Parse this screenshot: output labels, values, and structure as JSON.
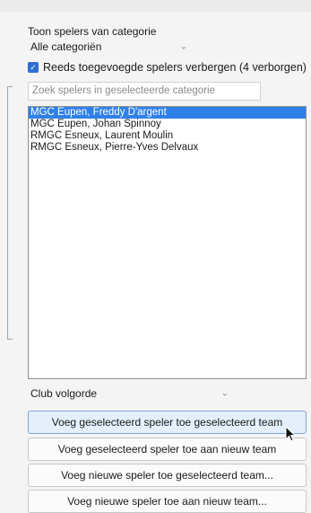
{
  "panel": {
    "category_label": "Toon spelers van categorie",
    "category_select": {
      "value": "Alle categoriën"
    },
    "hide_added": {
      "checked": true,
      "label": "Reeds toegevoegde spelers verbergen (4 verborgen)"
    },
    "search": {
      "placeholder": "Zoek spelers in geselecteerde categorie"
    },
    "players": [
      {
        "name": "MGC Eupen, Freddy D'argent",
        "selected": true
      },
      {
        "name": "MGC Eupen, Johan Spinnoy",
        "selected": false
      },
      {
        "name": "RMGC Esneux, Laurent Moulin",
        "selected": false
      },
      {
        "name": "RMGC Esneux, Pierre-Yves Delvaux",
        "selected": false
      }
    ],
    "sort_select": {
      "value": "Club volgorde"
    },
    "buttons": {
      "add_selected_to_selected": "Voeg geselecteerd speler toe geselecteerd team",
      "add_selected_to_new": "Voeg geselecteerd speler toe aan nieuw team",
      "add_new_to_selected": "Voeg nieuwe speler toe geselecteerd team...",
      "add_new_to_new": "Voeg nieuwe speler toe aan nieuw team..."
    },
    "colors": {
      "accent": "#2f80e8",
      "checkbox": "#2f6fd1"
    }
  }
}
